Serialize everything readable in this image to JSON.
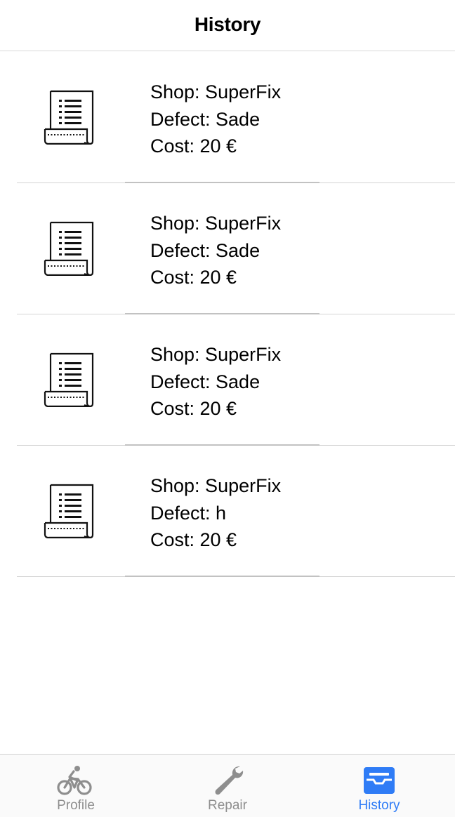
{
  "navbar": {
    "title": "History"
  },
  "history": [
    {
      "shop": "Shop: SuperFix",
      "defect": "Defect: Sade",
      "cost": "Cost: 20 €"
    },
    {
      "shop": "Shop: SuperFix",
      "defect": "Defect: Sade",
      "cost": "Cost: 20 €"
    },
    {
      "shop": "Shop: SuperFix",
      "defect": "Defect: Sade",
      "cost": "Cost: 20 €"
    },
    {
      "shop": "Shop: SuperFix",
      "defect": "Defect: h",
      "cost": "Cost: 20 €"
    }
  ],
  "tabbar": {
    "tabs": [
      {
        "label": "Profile",
        "icon": "bicycle-rider-icon",
        "active": false
      },
      {
        "label": "Repair",
        "icon": "wrench-icon",
        "active": false
      },
      {
        "label": "History",
        "icon": "tray-archive-icon",
        "active": true
      }
    ]
  },
  "colors": {
    "accent": "#2f7cf6",
    "inactive": "#8e8e8e",
    "separator": "#d4d4d4"
  }
}
